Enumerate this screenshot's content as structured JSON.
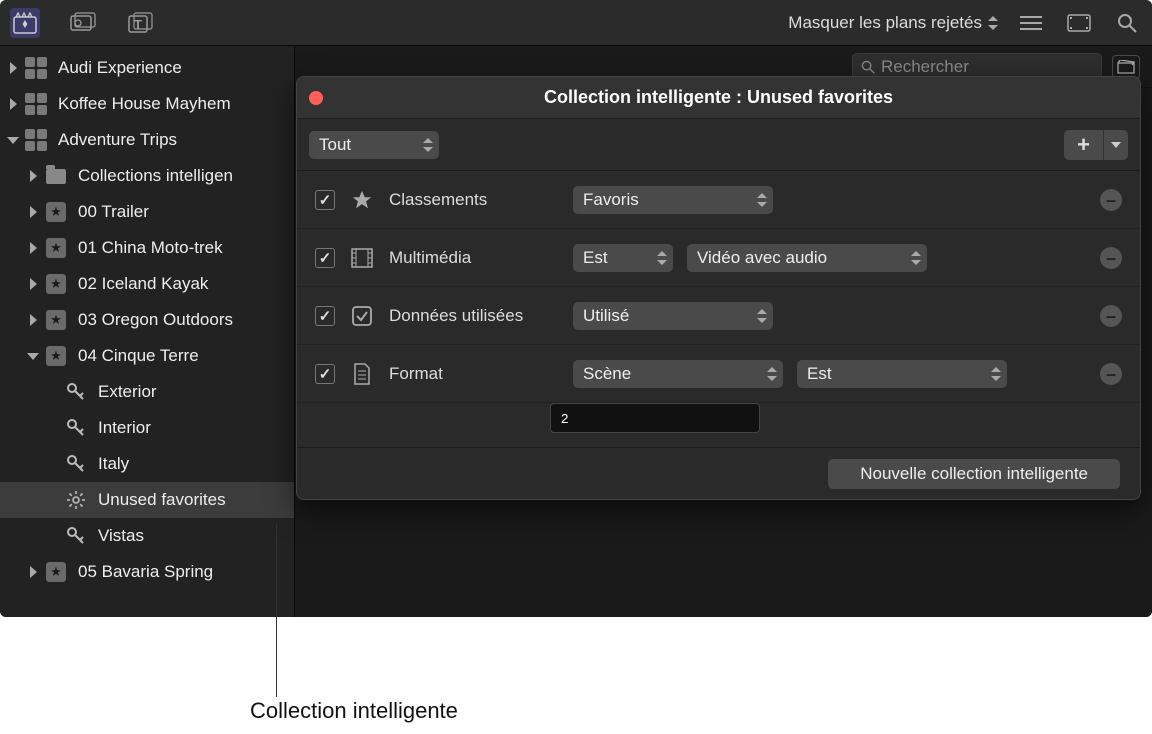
{
  "toolbar": {
    "reject_label": "Masquer les plans rejetés"
  },
  "search": {
    "placeholder": "Rechercher"
  },
  "sidebar": [
    {
      "label": "Audi Experience",
      "icon": "library",
      "indent": 0,
      "disclosure": "right"
    },
    {
      "label": "Koffee House Mayhem",
      "icon": "library",
      "indent": 0,
      "disclosure": "right"
    },
    {
      "label": "Adventure Trips",
      "icon": "library",
      "indent": 0,
      "disclosure": "down"
    },
    {
      "label": "Collections intelligen",
      "icon": "folder",
      "indent": 1,
      "disclosure": "right"
    },
    {
      "label": "00 Trailer",
      "icon": "star",
      "indent": 1,
      "disclosure": "right"
    },
    {
      "label": "01 China Moto-trek",
      "icon": "star",
      "indent": 1,
      "disclosure": "right"
    },
    {
      "label": "02 Iceland Kayak",
      "icon": "star",
      "indent": 1,
      "disclosure": "right"
    },
    {
      "label": "03 Oregon Outdoors",
      "icon": "star",
      "indent": 1,
      "disclosure": "right"
    },
    {
      "label": "04 Cinque Terre",
      "icon": "star",
      "indent": 1,
      "disclosure": "down"
    },
    {
      "label": "Exterior",
      "icon": "key",
      "indent": 2,
      "disclosure": "none"
    },
    {
      "label": "Interior",
      "icon": "key",
      "indent": 2,
      "disclosure": "none"
    },
    {
      "label": "Italy",
      "icon": "key",
      "indent": 2,
      "disclosure": "none"
    },
    {
      "label": "Unused favorites",
      "icon": "gear",
      "indent": 2,
      "disclosure": "none",
      "selected": true
    },
    {
      "label": "Vistas",
      "icon": "key",
      "indent": 2,
      "disclosure": "none"
    },
    {
      "label": "05 Bavaria Spring",
      "icon": "star",
      "indent": 1,
      "disclosure": "right"
    }
  ],
  "panel": {
    "title": "Collection intelligente : Unused favorites",
    "match": "Tout",
    "rules": [
      {
        "icon": "star",
        "label": "Classements",
        "selects": [
          "Favoris"
        ]
      },
      {
        "icon": "film",
        "label": "Multimédia",
        "selects": [
          "Est",
          "Vidéo avec audio"
        ]
      },
      {
        "icon": "checkbox",
        "label": "Données utilisées",
        "selects": [
          "Utilisé"
        ]
      },
      {
        "icon": "doc",
        "label": "Format",
        "selects": [
          "Scène",
          "Est"
        ],
        "input": "2"
      }
    ],
    "new_button": "Nouvelle collection intelligente"
  },
  "callout": "Collection intelligente"
}
